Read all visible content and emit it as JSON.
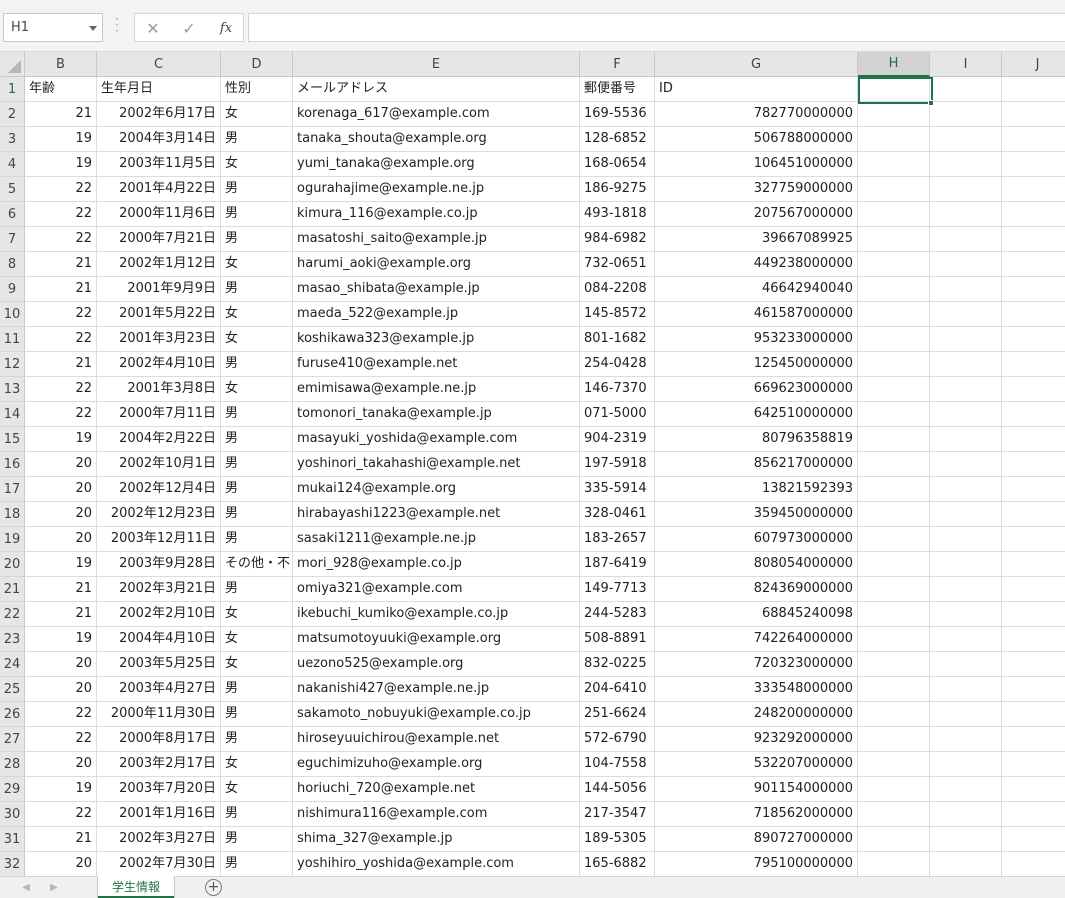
{
  "formula_bar": {
    "name_box": "H1",
    "cancel_icon": "✕",
    "enter_icon": "✓",
    "fx_label": "fx",
    "formula": ""
  },
  "grid": {
    "columns": [
      "B",
      "C",
      "D",
      "E",
      "F",
      "G",
      "H",
      "I",
      "J"
    ],
    "selected_column": "H",
    "active_cell": "H1",
    "header_row": {
      "row": "1",
      "cells": [
        "年齢",
        "生年月日",
        "性別",
        "メールアドレス",
        "郵便番号",
        "ID"
      ]
    },
    "rows": [
      {
        "row": "2",
        "age": "21",
        "birth": "2002年6月17日",
        "gender": "女",
        "email": "korenaga_617@example.com",
        "zip": "169-5536",
        "id": "782770000000"
      },
      {
        "row": "3",
        "age": "19",
        "birth": "2004年3月14日",
        "gender": "男",
        "email": "tanaka_shouta@example.org",
        "zip": "128-6852",
        "id": "506788000000"
      },
      {
        "row": "4",
        "age": "19",
        "birth": "2003年11月5日",
        "gender": "女",
        "email": "yumi_tanaka@example.org",
        "zip": "168-0654",
        "id": "106451000000"
      },
      {
        "row": "5",
        "age": "22",
        "birth": "2001年4月22日",
        "gender": "男",
        "email": "ogurahajime@example.ne.jp",
        "zip": "186-9275",
        "id": "327759000000"
      },
      {
        "row": "6",
        "age": "22",
        "birth": "2000年11月6日",
        "gender": "男",
        "email": "kimura_116@example.co.jp",
        "zip": "493-1818",
        "id": "207567000000"
      },
      {
        "row": "7",
        "age": "22",
        "birth": "2000年7月21日",
        "gender": "男",
        "email": "masatoshi_saito@example.jp",
        "zip": "984-6982",
        "id": "39667089925"
      },
      {
        "row": "8",
        "age": "21",
        "birth": "2002年1月12日",
        "gender": "女",
        "email": "harumi_aoki@example.org",
        "zip": "732-0651",
        "id": "449238000000"
      },
      {
        "row": "9",
        "age": "21",
        "birth": "2001年9月9日",
        "gender": "男",
        "email": "masao_shibata@example.jp",
        "zip": "084-2208",
        "id": "46642940040"
      },
      {
        "row": "10",
        "age": "22",
        "birth": "2001年5月22日",
        "gender": "女",
        "email": "maeda_522@example.jp",
        "zip": "145-8572",
        "id": "461587000000"
      },
      {
        "row": "11",
        "age": "22",
        "birth": "2001年3月23日",
        "gender": "女",
        "email": "koshikawa323@example.jp",
        "zip": "801-1682",
        "id": "953233000000"
      },
      {
        "row": "12",
        "age": "21",
        "birth": "2002年4月10日",
        "gender": "男",
        "email": "furuse410@example.net",
        "zip": "254-0428",
        "id": "125450000000"
      },
      {
        "row": "13",
        "age": "22",
        "birth": "2001年3月8日",
        "gender": "女",
        "email": "emimisawa@example.ne.jp",
        "zip": "146-7370",
        "id": "669623000000"
      },
      {
        "row": "14",
        "age": "22",
        "birth": "2000年7月11日",
        "gender": "男",
        "email": "tomonori_tanaka@example.jp",
        "zip": "071-5000",
        "id": "642510000000"
      },
      {
        "row": "15",
        "age": "19",
        "birth": "2004年2月22日",
        "gender": "男",
        "email": "masayuki_yoshida@example.com",
        "zip": "904-2319",
        "id": "80796358819"
      },
      {
        "row": "16",
        "age": "20",
        "birth": "2002年10月1日",
        "gender": "男",
        "email": "yoshinori_takahashi@example.net",
        "zip": "197-5918",
        "id": "856217000000"
      },
      {
        "row": "17",
        "age": "20",
        "birth": "2002年12月4日",
        "gender": "男",
        "email": "mukai124@example.org",
        "zip": "335-5914",
        "id": "13821592393"
      },
      {
        "row": "18",
        "age": "20",
        "birth": "2002年12月23日",
        "gender": "男",
        "email": "hirabayashi1223@example.net",
        "zip": "328-0461",
        "id": "359450000000"
      },
      {
        "row": "19",
        "age": "20",
        "birth": "2003年12月11日",
        "gender": "男",
        "email": "sasaki1211@example.ne.jp",
        "zip": "183-2657",
        "id": "607973000000"
      },
      {
        "row": "20",
        "age": "19",
        "birth": "2003年9月28日",
        "gender": "その他・不",
        "email": "mori_928@example.co.jp",
        "zip": "187-6419",
        "id": "808054000000"
      },
      {
        "row": "21",
        "age": "21",
        "birth": "2002年3月21日",
        "gender": "男",
        "email": "omiya321@example.com",
        "zip": "149-7713",
        "id": "824369000000"
      },
      {
        "row": "22",
        "age": "21",
        "birth": "2002年2月10日",
        "gender": "女",
        "email": "ikebuchi_kumiko@example.co.jp",
        "zip": "244-5283",
        "id": "68845240098"
      },
      {
        "row": "23",
        "age": "19",
        "birth": "2004年4月10日",
        "gender": "女",
        "email": "matsumotoyuuki@example.org",
        "zip": "508-8891",
        "id": "742264000000"
      },
      {
        "row": "24",
        "age": "20",
        "birth": "2003年5月25日",
        "gender": "女",
        "email": "uezono525@example.org",
        "zip": "832-0225",
        "id": "720323000000"
      },
      {
        "row": "25",
        "age": "20",
        "birth": "2003年4月27日",
        "gender": "男",
        "email": "nakanishi427@example.ne.jp",
        "zip": "204-6410",
        "id": "333548000000"
      },
      {
        "row": "26",
        "age": "22",
        "birth": "2000年11月30日",
        "gender": "男",
        "email": "sakamoto_nobuyuki@example.co.jp",
        "zip": "251-6624",
        "id": "248200000000"
      },
      {
        "row": "27",
        "age": "22",
        "birth": "2000年8月17日",
        "gender": "男",
        "email": "hiroseyuuichirou@example.net",
        "zip": "572-6790",
        "id": "923292000000"
      },
      {
        "row": "28",
        "age": "20",
        "birth": "2003年2月17日",
        "gender": "女",
        "email": "eguchimizuho@example.org",
        "zip": "104-7558",
        "id": "532207000000"
      },
      {
        "row": "29",
        "age": "19",
        "birth": "2003年7月20日",
        "gender": "女",
        "email": "horiuchi_720@example.net",
        "zip": "144-5056",
        "id": "901154000000"
      },
      {
        "row": "30",
        "age": "22",
        "birth": "2001年1月16日",
        "gender": "男",
        "email": "nishimura116@example.com",
        "zip": "217-3547",
        "id": "718562000000"
      },
      {
        "row": "31",
        "age": "21",
        "birth": "2002年3月27日",
        "gender": "男",
        "email": "shima_327@example.jp",
        "zip": "189-5305",
        "id": "890727000000"
      },
      {
        "row": "32",
        "age": "20",
        "birth": "2002年7月30日",
        "gender": "男",
        "email": "yoshihiro_yoshida@example.com",
        "zip": "165-6882",
        "id": "795100000000"
      }
    ]
  },
  "sheet_tabs": {
    "prev_icon": "◀",
    "next_icon": "▶",
    "active_tab": "学生情報",
    "add_icon": "+"
  },
  "colors": {
    "accent": "#217346",
    "header_bg": "#e6e6e6",
    "gridline": "#dcdcdc"
  }
}
